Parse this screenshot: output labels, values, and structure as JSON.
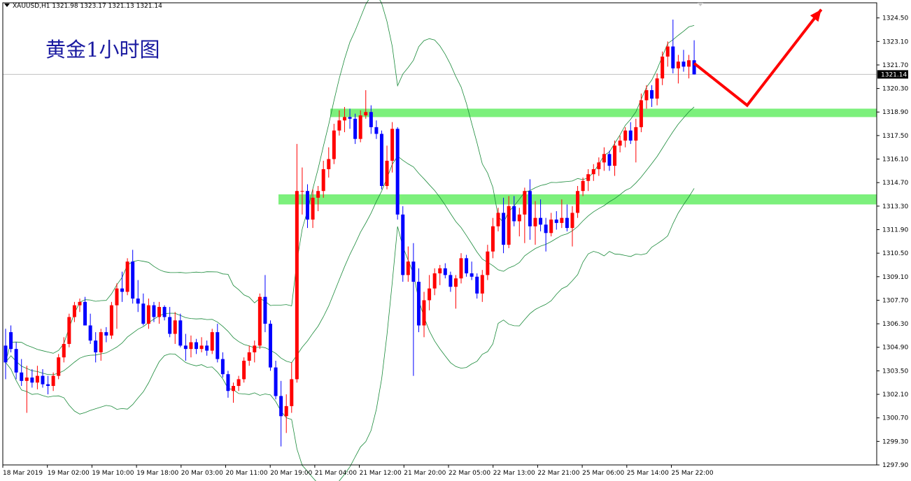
{
  "header": {
    "symbol": "XAUUSD,H1",
    "ohlc": "1321.98 1323.17 1321.13 1321.14"
  },
  "annotation": {
    "title": "黄金1小时图"
  },
  "colors": {
    "bull": "#ff0000",
    "bear": "#0000ff",
    "band": "#1a8a3a",
    "zone": "#7cf07c",
    "arrow": "#ff0000",
    "price_line": "#c0c0c0"
  },
  "chart_data": {
    "type": "candlestick",
    "symbol": "XAUUSD",
    "timeframe": "H1",
    "ylim": [
      1297.9,
      1325.4
    ],
    "current_price": "1321.14",
    "y_ticks": [
      "1324.50",
      "1323.10",
      "1321.70",
      "1320.30",
      "1318.90",
      "1317.50",
      "1316.10",
      "1314.70",
      "1313.30",
      "1311.90",
      "1310.50",
      "1309.10",
      "1307.70",
      "1306.30",
      "1304.90",
      "1303.50",
      "1302.10",
      "1300.70",
      "1299.30",
      "1297.90"
    ],
    "x_ticks": [
      "18 Mar 2019",
      "19 Mar 02:00",
      "19 Mar 10:00",
      "19 Mar 18:00",
      "20 Mar 03:00",
      "20 Mar 11:00",
      "20 Mar 19:00",
      "21 Mar 04:00",
      "21 Mar 12:00",
      "21 Mar 20:00",
      "22 Mar 05:00",
      "22 Mar 13:00",
      "22 Mar 21:00",
      "25 Mar 06:00",
      "25 Mar 14:00",
      "25 Mar 22:00"
    ],
    "candles_ohlc": [
      [
        1305.0,
        1306.0,
        1303.0,
        1304.0
      ],
      [
        1305.8,
        1306.2,
        1304.6,
        1304.8
      ],
      [
        1304.8,
        1305.2,
        1303.0,
        1303.4
      ],
      [
        1303.4,
        1304.2,
        1302.6,
        1302.9
      ],
      [
        1302.9,
        1303.8,
        1301.0,
        1303.1
      ],
      [
        1303.1,
        1303.6,
        1302.5,
        1302.8
      ],
      [
        1302.8,
        1303.8,
        1302.4,
        1303.2
      ],
      [
        1303.2,
        1303.6,
        1302.5,
        1302.7
      ],
      [
        1302.7,
        1303.2,
        1302.1,
        1302.6
      ],
      [
        1302.6,
        1303.4,
        1302.3,
        1303.2
      ],
      [
        1303.2,
        1304.5,
        1303.0,
        1304.3
      ],
      [
        1304.3,
        1305.5,
        1304.0,
        1305.1
      ],
      [
        1305.1,
        1306.9,
        1304.9,
        1306.7
      ],
      [
        1306.7,
        1307.6,
        1306.4,
        1307.4
      ],
      [
        1307.4,
        1307.8,
        1307.0,
        1307.6
      ],
      [
        1307.6,
        1307.9,
        1306.2,
        1306.2
      ],
      [
        1306.2,
        1306.9,
        1305.1,
        1305.3
      ],
      [
        1305.3,
        1305.8,
        1304.0,
        1304.6
      ],
      [
        1304.6,
        1306.0,
        1304.1,
        1305.8
      ],
      [
        1305.8,
        1306.1,
        1305.2,
        1305.6
      ],
      [
        1305.6,
        1307.6,
        1305.4,
        1307.4
      ],
      [
        1307.4,
        1308.7,
        1306.0,
        1308.4
      ],
      [
        1308.4,
        1309.4,
        1307.6,
        1308.2
      ],
      [
        1308.2,
        1310.2,
        1308.0,
        1310.0
      ],
      [
        1310.0,
        1310.7,
        1307.5,
        1307.8
      ],
      [
        1307.8,
        1308.9,
        1307.0,
        1307.5
      ],
      [
        1307.5,
        1308.1,
        1306.2,
        1306.3
      ],
      [
        1306.3,
        1307.8,
        1306.0,
        1307.4
      ],
      [
        1307.4,
        1307.6,
        1306.4,
        1306.7
      ],
      [
        1306.7,
        1307.6,
        1306.3,
        1307.3
      ],
      [
        1307.3,
        1307.4,
        1306.5,
        1306.7
      ],
      [
        1306.7,
        1307.3,
        1305.5,
        1305.7
      ],
      [
        1305.7,
        1307.0,
        1305.1,
        1306.5
      ],
      [
        1306.5,
        1306.9,
        1304.9,
        1305.0
      ],
      [
        1305.0,
        1305.7,
        1304.1,
        1304.8
      ],
      [
        1304.8,
        1305.6,
        1304.3,
        1305.2
      ],
      [
        1305.2,
        1305.4,
        1304.5,
        1304.8
      ],
      [
        1304.8,
        1305.5,
        1304.6,
        1305.0
      ],
      [
        1305.0,
        1305.3,
        1304.4,
        1304.7
      ],
      [
        1304.7,
        1306.0,
        1304.5,
        1305.8
      ],
      [
        1305.8,
        1306.3,
        1304.0,
        1304.2
      ],
      [
        1304.2,
        1304.6,
        1303.1,
        1303.3
      ],
      [
        1303.3,
        1303.5,
        1301.9,
        1302.3
      ],
      [
        1302.3,
        1302.8,
        1301.6,
        1302.6
      ],
      [
        1302.6,
        1303.2,
        1302.3,
        1303.0
      ],
      [
        1303.0,
        1304.3,
        1302.8,
        1304.1
      ],
      [
        1304.1,
        1305.0,
        1303.8,
        1304.6
      ],
      [
        1304.6,
        1305.3,
        1304.0,
        1305.0
      ],
      [
        1305.0,
        1308.1,
        1304.8,
        1307.9
      ],
      [
        1307.9,
        1309.2,
        1305.8,
        1306.3
      ],
      [
        1306.3,
        1306.5,
        1303.5,
        1303.7
      ],
      [
        1303.7,
        1304.1,
        1301.8,
        1302.0
      ],
      [
        1302.0,
        1302.9,
        1299.0,
        1300.8
      ],
      [
        1300.8,
        1302.1,
        1299.8,
        1301.4
      ],
      [
        1301.4,
        1304.0,
        1301.0,
        1303.0
      ],
      [
        1303.0,
        1317.0,
        1302.8,
        1314.2
      ],
      [
        1314.2,
        1315.6,
        1312.8,
        1314.2
      ],
      [
        1314.2,
        1314.6,
        1312.0,
        1312.5
      ],
      [
        1312.5,
        1314.3,
        1312.0,
        1313.8
      ],
      [
        1313.8,
        1314.5,
        1313.0,
        1314.2
      ],
      [
        1314.2,
        1316.0,
        1313.8,
        1315.5
      ],
      [
        1315.5,
        1316.8,
        1315.0,
        1316.1
      ],
      [
        1316.1,
        1318.2,
        1315.8,
        1317.8
      ],
      [
        1317.8,
        1319.0,
        1317.5,
        1318.4
      ],
      [
        1318.4,
        1319.2,
        1317.7,
        1318.6
      ],
      [
        1318.6,
        1319.1,
        1317.9,
        1318.5
      ],
      [
        1318.5,
        1318.8,
        1317.0,
        1317.3
      ],
      [
        1317.3,
        1319.0,
        1317.1,
        1318.7
      ],
      [
        1318.7,
        1320.2,
        1318.5,
        1318.9
      ],
      [
        1318.9,
        1319.3,
        1317.6,
        1318.0
      ],
      [
        1318.0,
        1318.4,
        1317.3,
        1317.6
      ],
      [
        1317.6,
        1317.8,
        1314.3,
        1314.5
      ],
      [
        1314.5,
        1316.9,
        1314.3,
        1316.0
      ],
      [
        1316.0,
        1318.3,
        1315.3,
        1317.9
      ],
      [
        1317.9,
        1318.0,
        1312.5,
        1312.8
      ],
      [
        1312.8,
        1313.3,
        1308.8,
        1309.2
      ],
      [
        1309.2,
        1310.9,
        1308.8,
        1310.0
      ],
      [
        1310.0,
        1311.1,
        1303.2,
        1308.8
      ],
      [
        1308.8,
        1309.6,
        1305.8,
        1306.2
      ],
      [
        1306.2,
        1308.2,
        1305.5,
        1307.7
      ],
      [
        1307.7,
        1309.2,
        1307.1,
        1308.4
      ],
      [
        1308.4,
        1309.6,
        1308.0,
        1309.3
      ],
      [
        1309.3,
        1309.8,
        1308.6,
        1309.6
      ],
      [
        1309.6,
        1309.9,
        1309.0,
        1309.2
      ],
      [
        1309.2,
        1309.4,
        1308.2,
        1308.5
      ],
      [
        1308.5,
        1309.2,
        1307.2,
        1309.0
      ],
      [
        1309.0,
        1310.5,
        1308.7,
        1310.2
      ],
      [
        1310.2,
        1310.4,
        1309.1,
        1309.3
      ],
      [
        1309.3,
        1310.0,
        1308.9,
        1309.1
      ],
      [
        1309.1,
        1309.3,
        1307.8,
        1308.1
      ],
      [
        1308.1,
        1309.5,
        1307.6,
        1309.2
      ],
      [
        1309.2,
        1311.0,
        1308.9,
        1310.6
      ],
      [
        1310.6,
        1312.6,
        1310.2,
        1312.1
      ],
      [
        1312.1,
        1313.2,
        1311.8,
        1312.9
      ],
      [
        1312.9,
        1313.8,
        1310.5,
        1311.0
      ],
      [
        1311.0,
        1313.9,
        1310.8,
        1313.3
      ],
      [
        1313.3,
        1313.9,
        1312.1,
        1312.4
      ],
      [
        1312.4,
        1313.2,
        1311.5,
        1312.8
      ],
      [
        1312.8,
        1314.4,
        1311.1,
        1314.2
      ],
      [
        1314.2,
        1314.9,
        1311.3,
        1312.1
      ],
      [
        1312.1,
        1313.6,
        1311.0,
        1312.6
      ],
      [
        1312.6,
        1313.7,
        1311.8,
        1312.2
      ],
      [
        1312.2,
        1312.6,
        1310.6,
        1311.7
      ],
      [
        1311.7,
        1312.9,
        1311.5,
        1312.5
      ],
      [
        1312.5,
        1313.0,
        1311.9,
        1312.3
      ],
      [
        1312.3,
        1313.7,
        1312.0,
        1312.6
      ],
      [
        1312.6,
        1313.4,
        1311.8,
        1312.0
      ],
      [
        1312.0,
        1313.3,
        1310.9,
        1312.9
      ],
      [
        1312.9,
        1314.5,
        1312.6,
        1314.2
      ],
      [
        1314.2,
        1315.0,
        1313.9,
        1314.8
      ],
      [
        1314.8,
        1315.5,
        1314.2,
        1315.2
      ],
      [
        1315.2,
        1315.8,
        1314.8,
        1315.5
      ],
      [
        1315.5,
        1316.2,
        1315.1,
        1315.9
      ],
      [
        1315.9,
        1316.8,
        1315.4,
        1316.4
      ],
      [
        1316.4,
        1316.6,
        1315.4,
        1315.7
      ],
      [
        1315.7,
        1317.2,
        1315.1,
        1316.9
      ],
      [
        1316.9,
        1317.5,
        1316.5,
        1317.2
      ],
      [
        1317.2,
        1318.0,
        1316.8,
        1317.8
      ],
      [
        1317.8,
        1318.3,
        1317.0,
        1317.2
      ],
      [
        1317.2,
        1318.5,
        1315.9,
        1318.0
      ],
      [
        1318.0,
        1320.0,
        1317.7,
        1319.6
      ],
      [
        1319.6,
        1320.5,
        1319.1,
        1320.2
      ],
      [
        1320.2,
        1320.5,
        1319.2,
        1319.7
      ],
      [
        1319.7,
        1321.2,
        1319.3,
        1320.9
      ],
      [
        1320.9,
        1322.5,
        1320.5,
        1322.2
      ],
      [
        1322.2,
        1323.1,
        1321.6,
        1322.8
      ],
      [
        1322.8,
        1324.4,
        1321.2,
        1321.5
      ],
      [
        1321.5,
        1322.3,
        1320.6,
        1321.9
      ],
      [
        1321.9,
        1322.6,
        1321.3,
        1321.6
      ],
      [
        1321.6,
        1322.3,
        1320.9,
        1321.98
      ],
      [
        1321.98,
        1323.17,
        1321.13,
        1321.14
      ]
    ],
    "bollinger_last": {
      "upper": 1324.0,
      "middle": 1318.8,
      "lower": 1314.2
    },
    "support_zones": [
      {
        "low": 1318.6,
        "high": 1319.1
      },
      {
        "low": 1313.4,
        "high": 1314.0
      }
    ],
    "forecast_path": [
      {
        "bar": 130,
        "price": 1321.8
      },
      {
        "bar": 140,
        "price": 1319.3
      },
      {
        "bar": 154,
        "price": 1325.0
      }
    ],
    "grid": false,
    "legend": "none"
  }
}
